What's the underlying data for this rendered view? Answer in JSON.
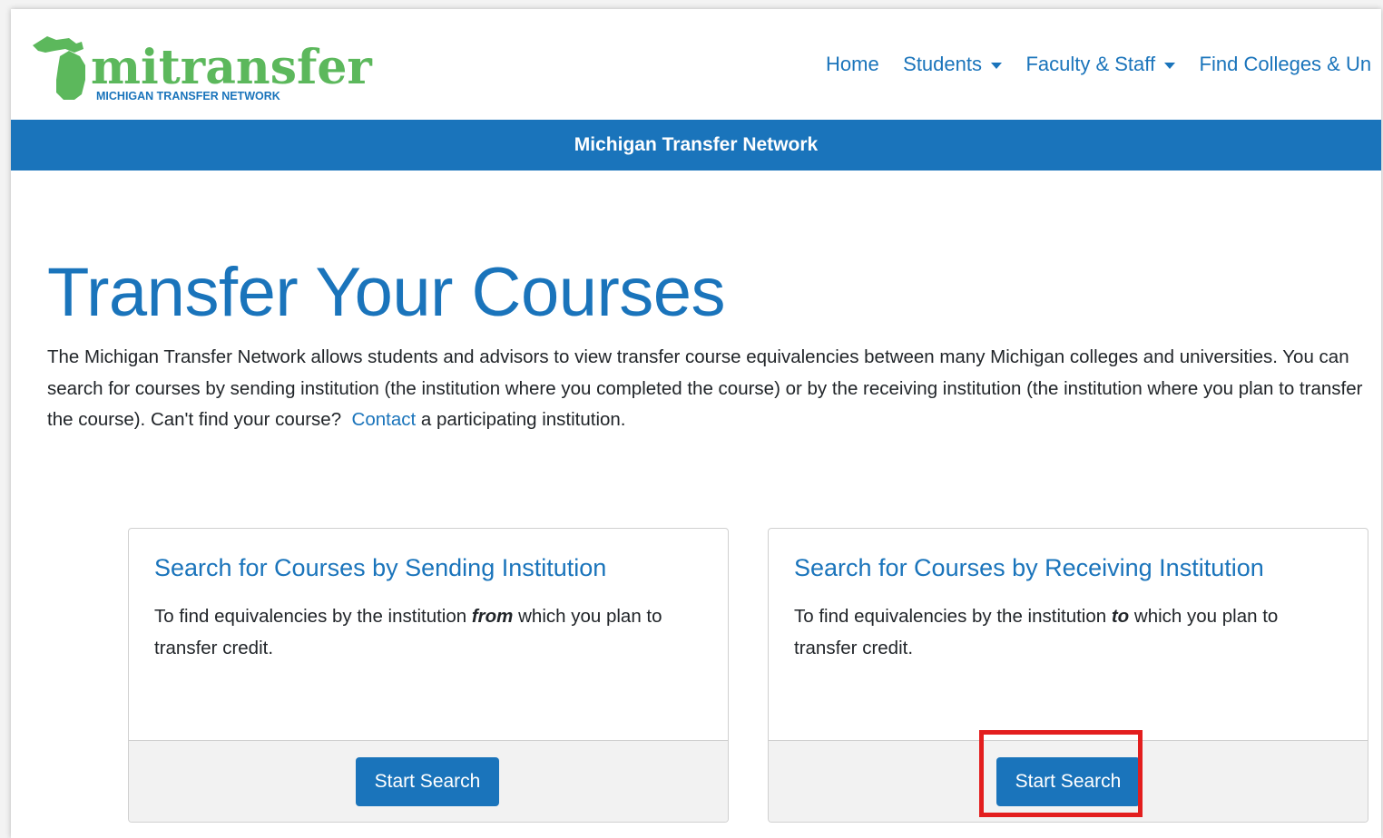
{
  "brand": {
    "logo_word": "mitransfer",
    "logo_tagline": "MICHIGAN TRANSFER NETWORK",
    "logo_color": "#5cb85c",
    "logo_text_color": "#1a74bb"
  },
  "nav": {
    "items": [
      {
        "label": "Home",
        "dropdown": false
      },
      {
        "label": "Students",
        "dropdown": true
      },
      {
        "label": "Faculty & Staff",
        "dropdown": true
      },
      {
        "label": "Find Colleges & Un",
        "dropdown": false
      }
    ]
  },
  "banner": {
    "title": "Michigan Transfer Network"
  },
  "hero": {
    "title": "Transfer Your Courses",
    "intro_text": "The Michigan Transfer Network allows students and advisors to view transfer course equivalencies between many Michigan colleges and universities.  You can search for courses by sending institution (the institution where you completed the course) or by the receiving institution (the institution where you plan to transfer the course). Can't find your course?",
    "contact_link": "Contact",
    "intro_suffix": "a participating institution."
  },
  "cards": [
    {
      "title": "Search for Courses by Sending Institution",
      "text_before": "To find equivalencies by the institution",
      "text_emphasis": "from",
      "text_after": "which you plan to transfer credit.",
      "button": "Start Search"
    },
    {
      "title": "Search for Courses by Receiving Institution",
      "text_before": "To find equivalencies by the institution",
      "text_emphasis": "to",
      "text_after": "which you plan to transfer credit.",
      "button": "Start Search"
    }
  ],
  "colors": {
    "accent": "#1a74bb",
    "highlight": "#e31e1e",
    "footer_bg": "#f2f2f2"
  }
}
